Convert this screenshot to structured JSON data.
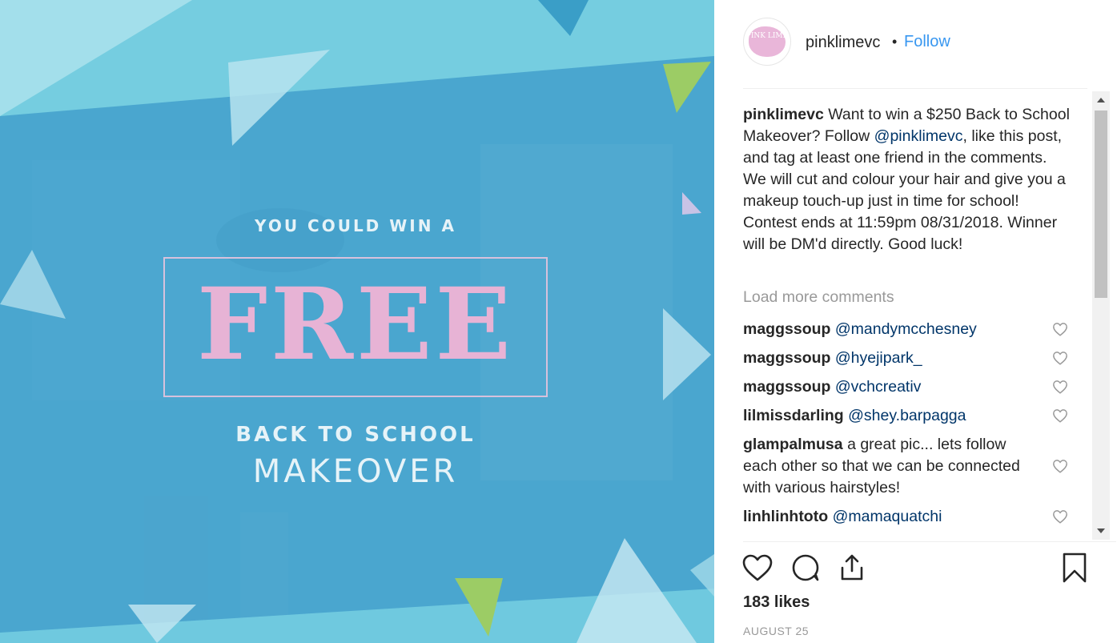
{
  "image": {
    "line1": "YOU COULD WIN A",
    "big_word": "FREE",
    "line3": "BACK TO SCHOOL",
    "line4": "MAKEOVER",
    "colors": {
      "background": "#4aa6cf",
      "accent_pink": "#e7b3d5",
      "accent_green": "#9ccc65"
    }
  },
  "header": {
    "avatar_text": "PINK LIME",
    "username": "pinklimevc",
    "separator": "•",
    "follow_label": "Follow"
  },
  "caption": {
    "username": "pinklimevc",
    "text_before": "Want to win a $250 Back to School Makeover? Follow",
    "mention": "@pinklimevc",
    "text_after": ", like this post, and tag at least one friend in the comments. We will cut and colour your hair and give you a makeup touch-up just in time for school! Contest ends at 11:59pm 08/31/2018. Winner will be DM'd directly. Good luck!"
  },
  "load_more": "Load more comments",
  "comments": [
    {
      "username": "maggssoup",
      "text": "@mandymcchesney"
    },
    {
      "username": "maggssoup",
      "text": "@hyejipark_"
    },
    {
      "username": "maggssoup",
      "text": "@vchcreativ"
    },
    {
      "username": "lilmissdarling",
      "text": "@shey.barpagga"
    },
    {
      "username": "glampalmusa",
      "text": "a great pic... lets follow each other so that we can be connected with various hairstyles!"
    },
    {
      "username": "linhlinhtoto",
      "text": "@mamaquatchi"
    }
  ],
  "actions": {
    "like_icon": "heart-icon",
    "comment_icon": "comment-icon",
    "share_icon": "share-icon",
    "save_icon": "bookmark-icon"
  },
  "likes": "183 likes",
  "date": "AUGUST 25"
}
